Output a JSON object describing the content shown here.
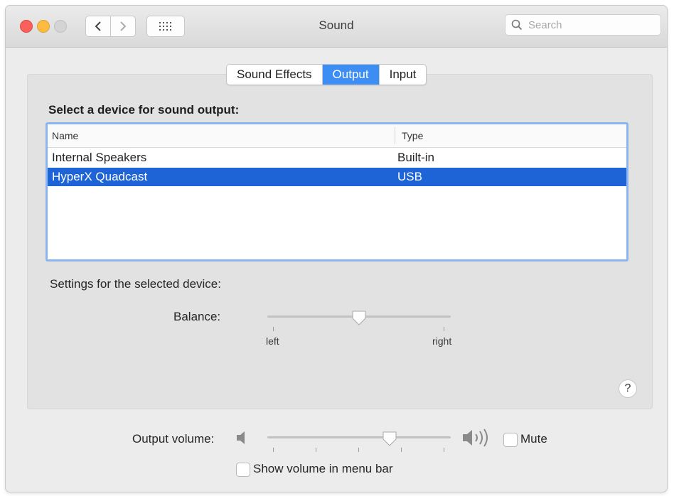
{
  "window": {
    "title": "Sound"
  },
  "search": {
    "placeholder": "Search"
  },
  "tabs": [
    {
      "label": "Sound Effects",
      "active": false
    },
    {
      "label": "Output",
      "active": true
    },
    {
      "label": "Input",
      "active": false
    }
  ],
  "output": {
    "section_title": "Select a device for sound output:",
    "columns": {
      "name": "Name",
      "type": "Type"
    },
    "devices": [
      {
        "name": "Internal Speakers",
        "type": "Built-in",
        "selected": false
      },
      {
        "name": "HyperX Quadcast",
        "type": "USB",
        "selected": true
      }
    ],
    "settings_label": "Settings for the selected device:",
    "balance": {
      "label": "Balance:",
      "left_label": "left",
      "right_label": "right",
      "value": 0.5
    }
  },
  "help": {
    "glyph": "?"
  },
  "volume": {
    "label": "Output volume:",
    "value": 0.67,
    "mute_label": "Mute",
    "mute_checked": false,
    "show_in_menu_bar_label": "Show volume in menu bar",
    "show_in_menu_bar_checked": false
  },
  "colors": {
    "accent": "#3c8ef5",
    "selection": "#1f64d6",
    "table_border": "#8ab4f2"
  },
  "icons": [
    "back-chevron-icon",
    "forward-chevron-icon",
    "grid-icon",
    "search-icon",
    "speaker-low-icon",
    "speaker-high-icon",
    "help-icon"
  ]
}
